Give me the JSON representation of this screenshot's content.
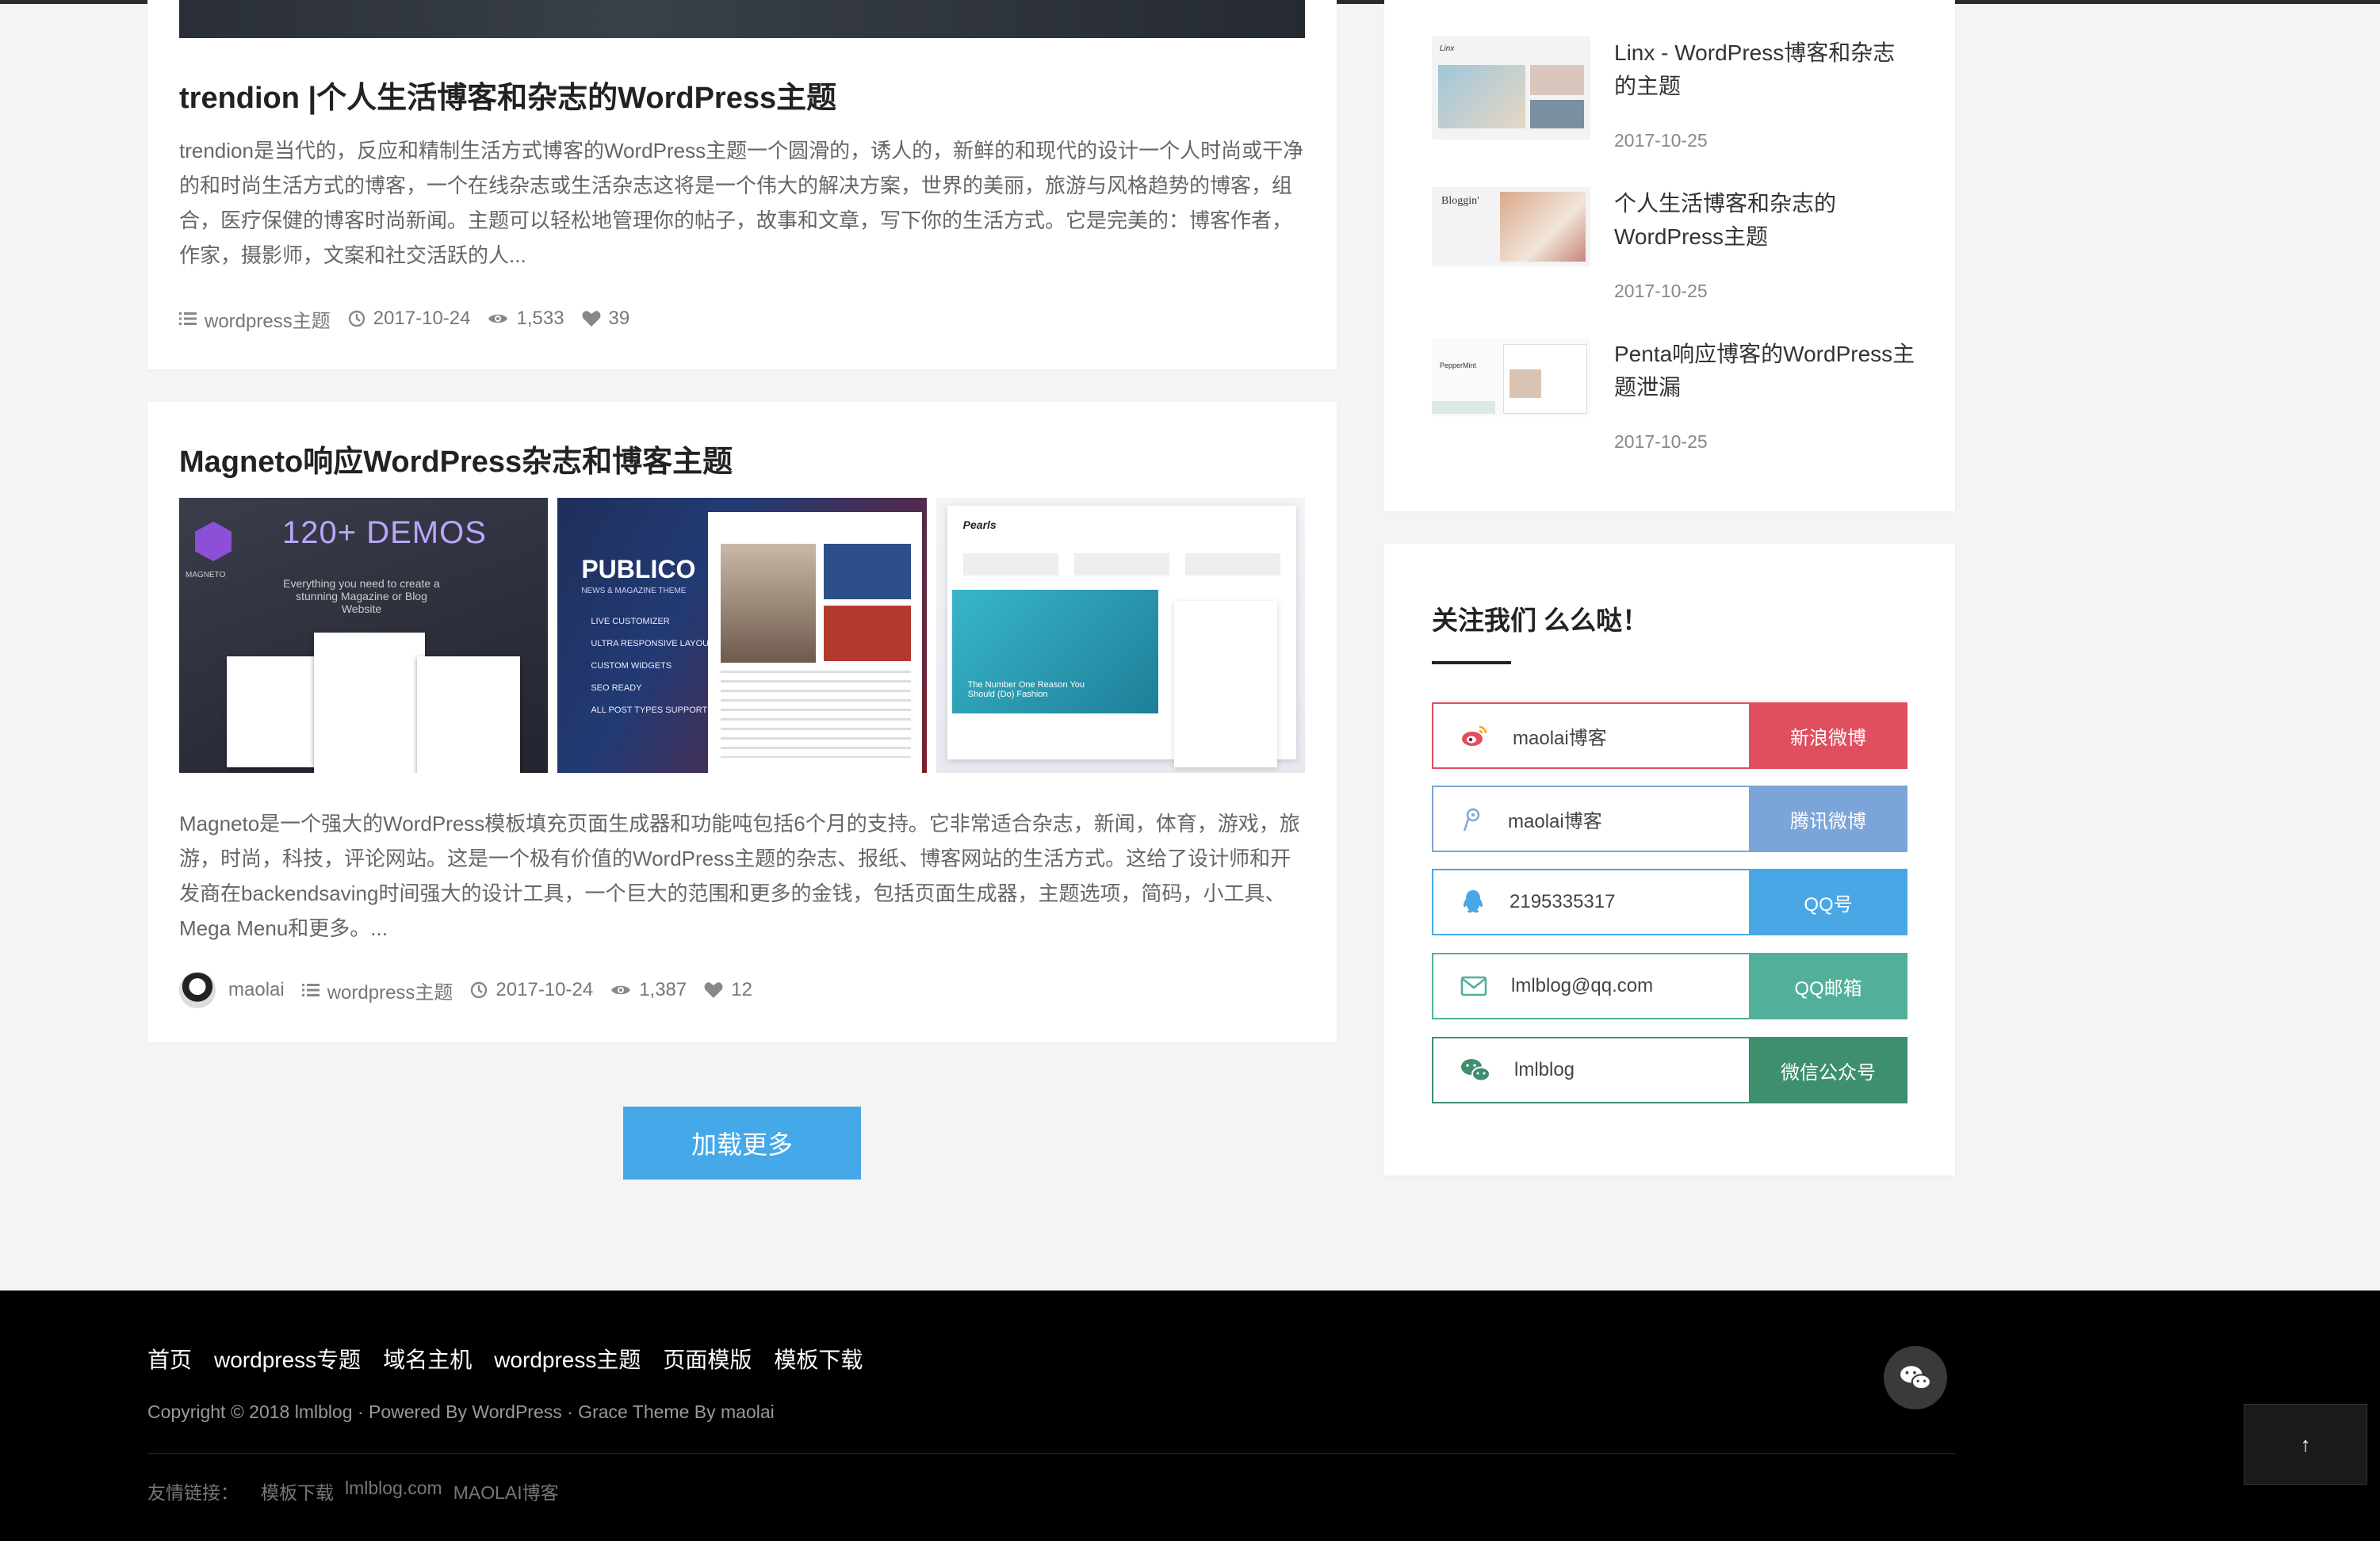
{
  "posts": [
    {
      "title": "trendion |个人生活博客和杂志的WordPress主题",
      "excerpt": "trendion是当代的，反应和精制生活方式博客的WordPress主题一个圆滑的，诱人的，新鲜的和现代的设计一个人时尚或干净的和时尚生活方式的博客，一个在线杂志或生活杂志这将是一个伟大的解决方案，世界的美丽，旅游与风格趋势的博客，组合，医疗保健的博客时尚新闻。主题可以轻松地管理你的帖子，故事和文章，写下你的生活方式。它是完美的：博客作者，作家，摄影师，文案和社交活跃的人...",
      "category": "wordpress主题",
      "date": "2017-10-24",
      "views": "1,533",
      "likes": "39"
    },
    {
      "title": "Magneto响应WordPress杂志和博客主题",
      "excerpt": "Magneto是一个强大的WordPress模板填充页面生成器和功能吨包括6个月的支持。它非常适合杂志，新闻，体育，游戏，旅游，时尚，科技，评论网站。这是一个极有价值的WordPress主题的杂志、报纸、博客网站的生活方式。这给了设计师和开发商在backendsaving时间强大的设计工具，一个巨大的范围和更多的金钱，包括页面生成器，主题选项，简码，小工具、Mega Menu和更多。...",
      "author": "maolai",
      "category": "wordpress主题",
      "date": "2017-10-24",
      "views": "1,387",
      "likes": "12",
      "thumbs": {
        "magneto_big": "120+ DEMOS",
        "magneto_sub": "Everything you need to create a stunning Magazine or Blog Website",
        "magneto_logo": "MAGNETO",
        "publico_title": "PUBLICO",
        "publico_sub": "NEWS & MAGAZINE THEME",
        "publico_features": [
          "LIVE CUSTOMIZER",
          "ULTRA RESPONSIVE LAYOUT",
          "CUSTOM WIDGETS",
          "SEO READY",
          "ALL POST TYPES SUPPORT"
        ],
        "pearls_logo": "Pearls",
        "pearls_caption": "The Number One Reason You Should (Do) Fashion"
      }
    }
  ],
  "load_more": "加载更多",
  "recent_posts": [
    {
      "title": "Linx - WordPress博客和杂志的主题",
      "date": "2017-10-25",
      "thumb_text": "Linx"
    },
    {
      "title": "个人生活博客和杂志的WordPress主题",
      "date": "2017-10-25",
      "thumb_text": "Bloggin'"
    },
    {
      "title": "Penta响应博客的WordPress主题泄漏",
      "date": "2017-10-25",
      "thumb_text": "PepperMint"
    }
  ],
  "follow": {
    "title": "关注我们 么么哒！",
    "items": [
      {
        "icon": "weibo-icon",
        "value": "maolai博客",
        "label": "新浪微博",
        "color": "#e04f5f"
      },
      {
        "icon": "tencent-weibo-icon",
        "value": "maolai博客",
        "label": "腾讯微博",
        "color": "#7ba4d9"
      },
      {
        "icon": "qq-icon",
        "value": "2195335317",
        "label": "QQ号",
        "color": "#4aa7e6"
      },
      {
        "icon": "mail-icon",
        "value": "lmlblog@qq.com",
        "label": "QQ邮箱",
        "color": "#52b09a"
      },
      {
        "icon": "wechat-icon",
        "value": "lmlblog",
        "label": "微信公众号",
        "color": "#3d8f6e"
      }
    ]
  },
  "footer": {
    "nav": [
      "首页",
      "wordpress专题",
      "域名主机",
      "wordpress主题",
      "页面模版",
      "模板下载"
    ],
    "copyright": "Copyright © 2018 lmlblog · Powered By WordPress · Grace Theme By maolai",
    "links_label": "友情链接：",
    "links": [
      "模板下载",
      "lmlblog.com",
      "MAOLAI博客"
    ]
  },
  "back_top": "↑"
}
